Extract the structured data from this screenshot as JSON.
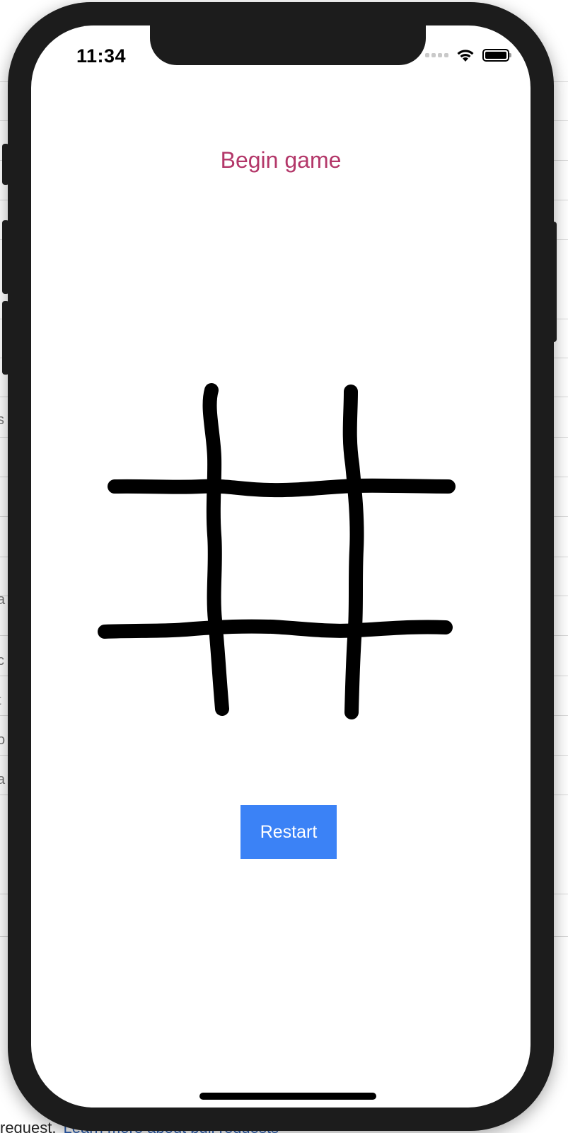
{
  "status_bar": {
    "time": "11:34"
  },
  "game": {
    "title": "Begin game",
    "restart_label": "Restart"
  },
  "colors": {
    "title": "#b33769",
    "button_bg": "#3b82f6",
    "button_text": "#ffffff",
    "grid_stroke": "#000000"
  },
  "background": {
    "footer_text": "request.",
    "footer_link": "Learn more about pull requests"
  },
  "icons": [
    "signal-icon",
    "wifi-icon",
    "battery-icon"
  ]
}
